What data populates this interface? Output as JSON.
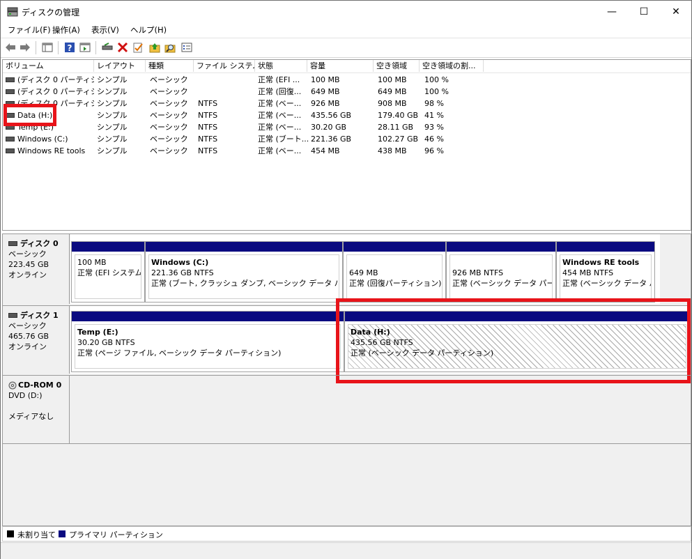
{
  "window": {
    "title": "ディスクの管理",
    "minimize": "—",
    "maximize": "☐",
    "close": "✕"
  },
  "menu": [
    "ファイル(F)",
    "操作(A)",
    "表示(V)",
    "ヘルプ(H)"
  ],
  "volume_list": {
    "columns": [
      "ボリューム",
      "レイアウト",
      "種類",
      "ファイル システム",
      "状態",
      "容量",
      "空き領域",
      "空き領域の割..."
    ],
    "rows": [
      [
        "(ディスク 0 パーティシ...",
        "シンプル",
        "ベーシック",
        "",
        "正常 (EFI ...",
        "100 MB",
        "100 MB",
        "100 %"
      ],
      [
        "(ディスク 0 パーティシ...",
        "シンプル",
        "ベーシック",
        "",
        "正常 (回復...",
        "649 MB",
        "649 MB",
        "100 %"
      ],
      [
        "(ディスク 0 パーティシ...",
        "シンプル",
        "ベーシック",
        "NTFS",
        "正常 (ベー...",
        "926 MB",
        "908 MB",
        "98 %"
      ],
      [
        "Data (H:)",
        "シンプル",
        "ベーシック",
        "NTFS",
        "正常 (ベー...",
        "435.56 GB",
        "179.40 GB",
        "41 %"
      ],
      [
        "Temp (E:)",
        "シンプル",
        "ベーシック",
        "NTFS",
        "正常 (ベー...",
        "30.20 GB",
        "28.11 GB",
        "93 %"
      ],
      [
        "Windows (C:)",
        "シンプル",
        "ベーシック",
        "NTFS",
        "正常 (ブート...",
        "221.36 GB",
        "102.27 GB",
        "46 %"
      ],
      [
        "Windows RE tools",
        "シンプル",
        "ベーシック",
        "NTFS",
        "正常 (ベー...",
        "454 MB",
        "438 MB",
        "96 %"
      ]
    ]
  },
  "disks": [
    {
      "name": "ディスク 0",
      "type": "ベーシック",
      "size": "223.45 GB",
      "status": "オンライン",
      "partitions": [
        {
          "name": "",
          "size": "100 MB",
          "status": "正常 (EFI システム"
        },
        {
          "name": "Windows  (C:)",
          "size": "221.36 GB NTFS",
          "status": "正常 (ブート, クラッシュ ダンプ, ベーシック データ パーティシ"
        },
        {
          "name": "",
          "size": "649 MB",
          "status": "正常 (回復パーティション)"
        },
        {
          "name": "",
          "size": "926 MB NTFS",
          "status": "正常 (ベーシック データ パーティ"
        },
        {
          "name": "Windows RE tools",
          "size": "454 MB NTFS",
          "status": "正常 (ベーシック データ パー"
        }
      ]
    },
    {
      "name": "ディスク 1",
      "type": "ベーシック",
      "size": "465.76 GB",
      "status": "オンライン",
      "partitions": [
        {
          "name": "Temp  (E:)",
          "size": "30.20 GB NTFS",
          "status": "正常 (ページ ファイル, ベーシック データ パーティション)"
        },
        {
          "name": "Data  (H:)",
          "size": "435.56 GB NTFS",
          "status": "正常 (ベーシック データ パーティション)"
        }
      ]
    },
    {
      "name": "CD-ROM 0",
      "type": "DVD (D:)",
      "status": "メディアなし"
    }
  ],
  "legend": {
    "unallocated": "未割り当て",
    "primary": "プライマリ パーティション"
  },
  "colors": {
    "primary": "#0a0a80",
    "unallocated": "#000000",
    "highlight": "#e8141a"
  }
}
